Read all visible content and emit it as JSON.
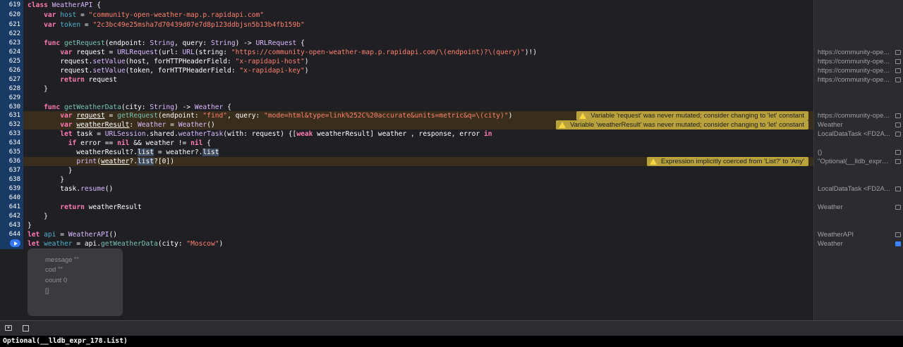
{
  "gutter": {
    "line_numbers": [
      "619",
      "620",
      "621",
      "622",
      "623",
      "624",
      "625",
      "626",
      "627",
      "628",
      "629",
      "630",
      "631",
      "632",
      "633",
      "634",
      "635",
      "636",
      "637",
      "638",
      "639",
      "640",
      "641",
      "642",
      "643",
      "644"
    ]
  },
  "code": {
    "host_literal": "\"community-open-weather-map.p.rapidapi.com\"",
    "token_literal": "\"2c3bc49e25msha7d70439d07e7d8p123ddbjsn5b13b4fb159b\"",
    "url_literal": "\"https://community-open-weather-map.p.rapidapi.com/\\(endpoint)?\\(query)\"",
    "host_header": "\"x-rapidapi-host\"",
    "key_header": "\"x-rapidapi-key\"",
    "find_literal": "\"find\"",
    "query_literal": "\"mode=html&type=link%252C%20accurate&units=metric&q=\\(city)\"",
    "city_literal": "\"Moscow\""
  },
  "warnings": {
    "request": "Variable 'request' was never mutated; consider changing to 'let' constant",
    "weatherResult": "Variable 'weatherResult' was never mutated; consider changing to 'let' constant",
    "coerced": "Expression implicitly coerced from 'List?' to 'Any'"
  },
  "results": [
    {
      "text": "https://community-ope..."
    },
    {
      "text": "https://community-ope..."
    },
    {
      "text": "https://community-ope..."
    },
    {
      "text": "https://community-ope..."
    },
    {
      "text": "https://community-ope..."
    },
    {
      "text": "Weather"
    },
    {
      "text": "LocalDataTask <FD2A..."
    },
    {
      "text": "()"
    },
    {
      "text": "\"Optional(__lldb_expr_1..."
    },
    {
      "text": "LocalDataTask <FD2A..."
    },
    {
      "text": "Weather"
    },
    {
      "text": "WeatherAPI"
    },
    {
      "text": "Weather"
    }
  ],
  "popover": {
    "lines": [
      "message \"\"",
      "cod \"\"",
      "count 0",
      "[]"
    ]
  },
  "console": {
    "output": "Optional(__lldb_expr_178.List)"
  },
  "colors": {
    "editor_bg": "#1f1f24",
    "keyword": "#ff7ab2",
    "string": "#ff8170",
    "type": "#dabaff",
    "warning_badge": "#b9a23c",
    "run_button": "#3478f6"
  }
}
